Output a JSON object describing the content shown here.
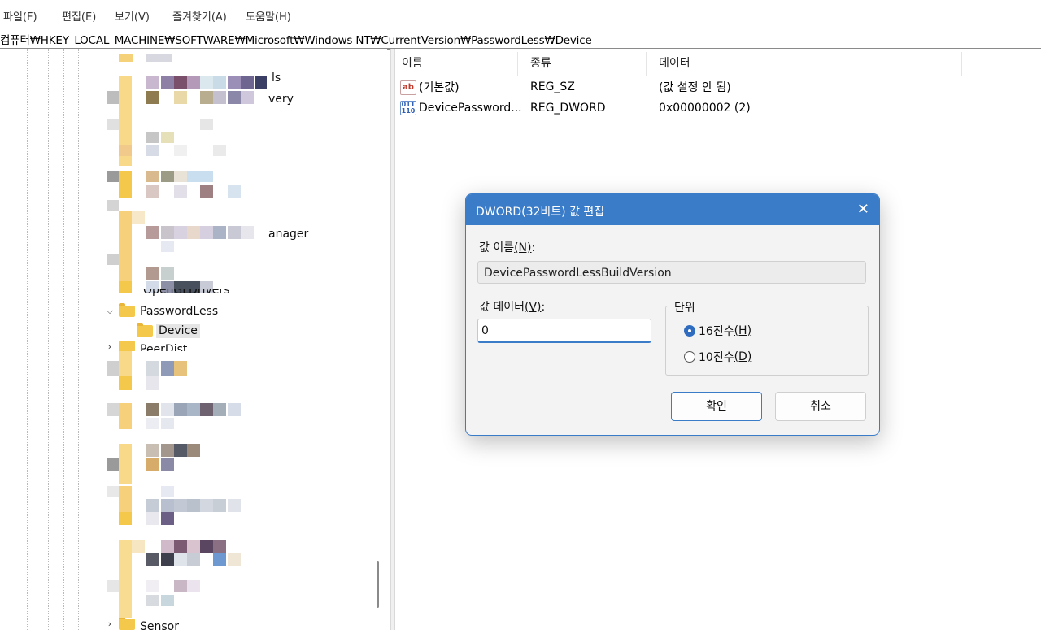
{
  "menu": [
    "파일(F)",
    "편집(E)",
    "보기(V)",
    "즐겨찾기(A)",
    "도움말(H)"
  ],
  "address": "컴퓨터₩HKEY_LOCAL_MACHINE₩SOFTWARE₩Microsoft₩Windows NT₩CurrentVersion₩PasswordLess₩Device",
  "tree": {
    "fragments": [
      "ls",
      "very",
      "anager"
    ],
    "partial_top": "OpenGLDrivers",
    "passwordless": "PasswordLess",
    "device": "Device",
    "partial_next": "PeerDist",
    "partial_bottom": "Sensor"
  },
  "list": {
    "headers": [
      "이름",
      "종류",
      "데이터"
    ],
    "rows": [
      {
        "icon": "string-value-icon",
        "name": "(기본값)",
        "type": "REG_SZ",
        "data": "(값 설정 안 됨)"
      },
      {
        "icon": "binary-value-icon",
        "name": "DevicePassword...",
        "type": "REG_DWORD",
        "data": "0x00000002 (2)"
      }
    ]
  },
  "dialog": {
    "title": "DWORD(32비트) 값 편집",
    "name_label": "값 이름",
    "name_label_key": "(N)",
    "name_value": "DevicePasswordLessBuildVersion",
    "data_label": "값 데이터",
    "data_label_key": "(V)",
    "data_value": "0",
    "base_legend": "단위",
    "radio_hex": "16진수",
    "radio_hex_key": "(H)",
    "radio_dec": "10진수",
    "radio_dec_key": "(D)",
    "selected_base": "hex",
    "ok": "확인",
    "cancel": "취소"
  },
  "colors": {
    "accent": "#3b7cc8",
    "folder": "#f4c84a"
  }
}
